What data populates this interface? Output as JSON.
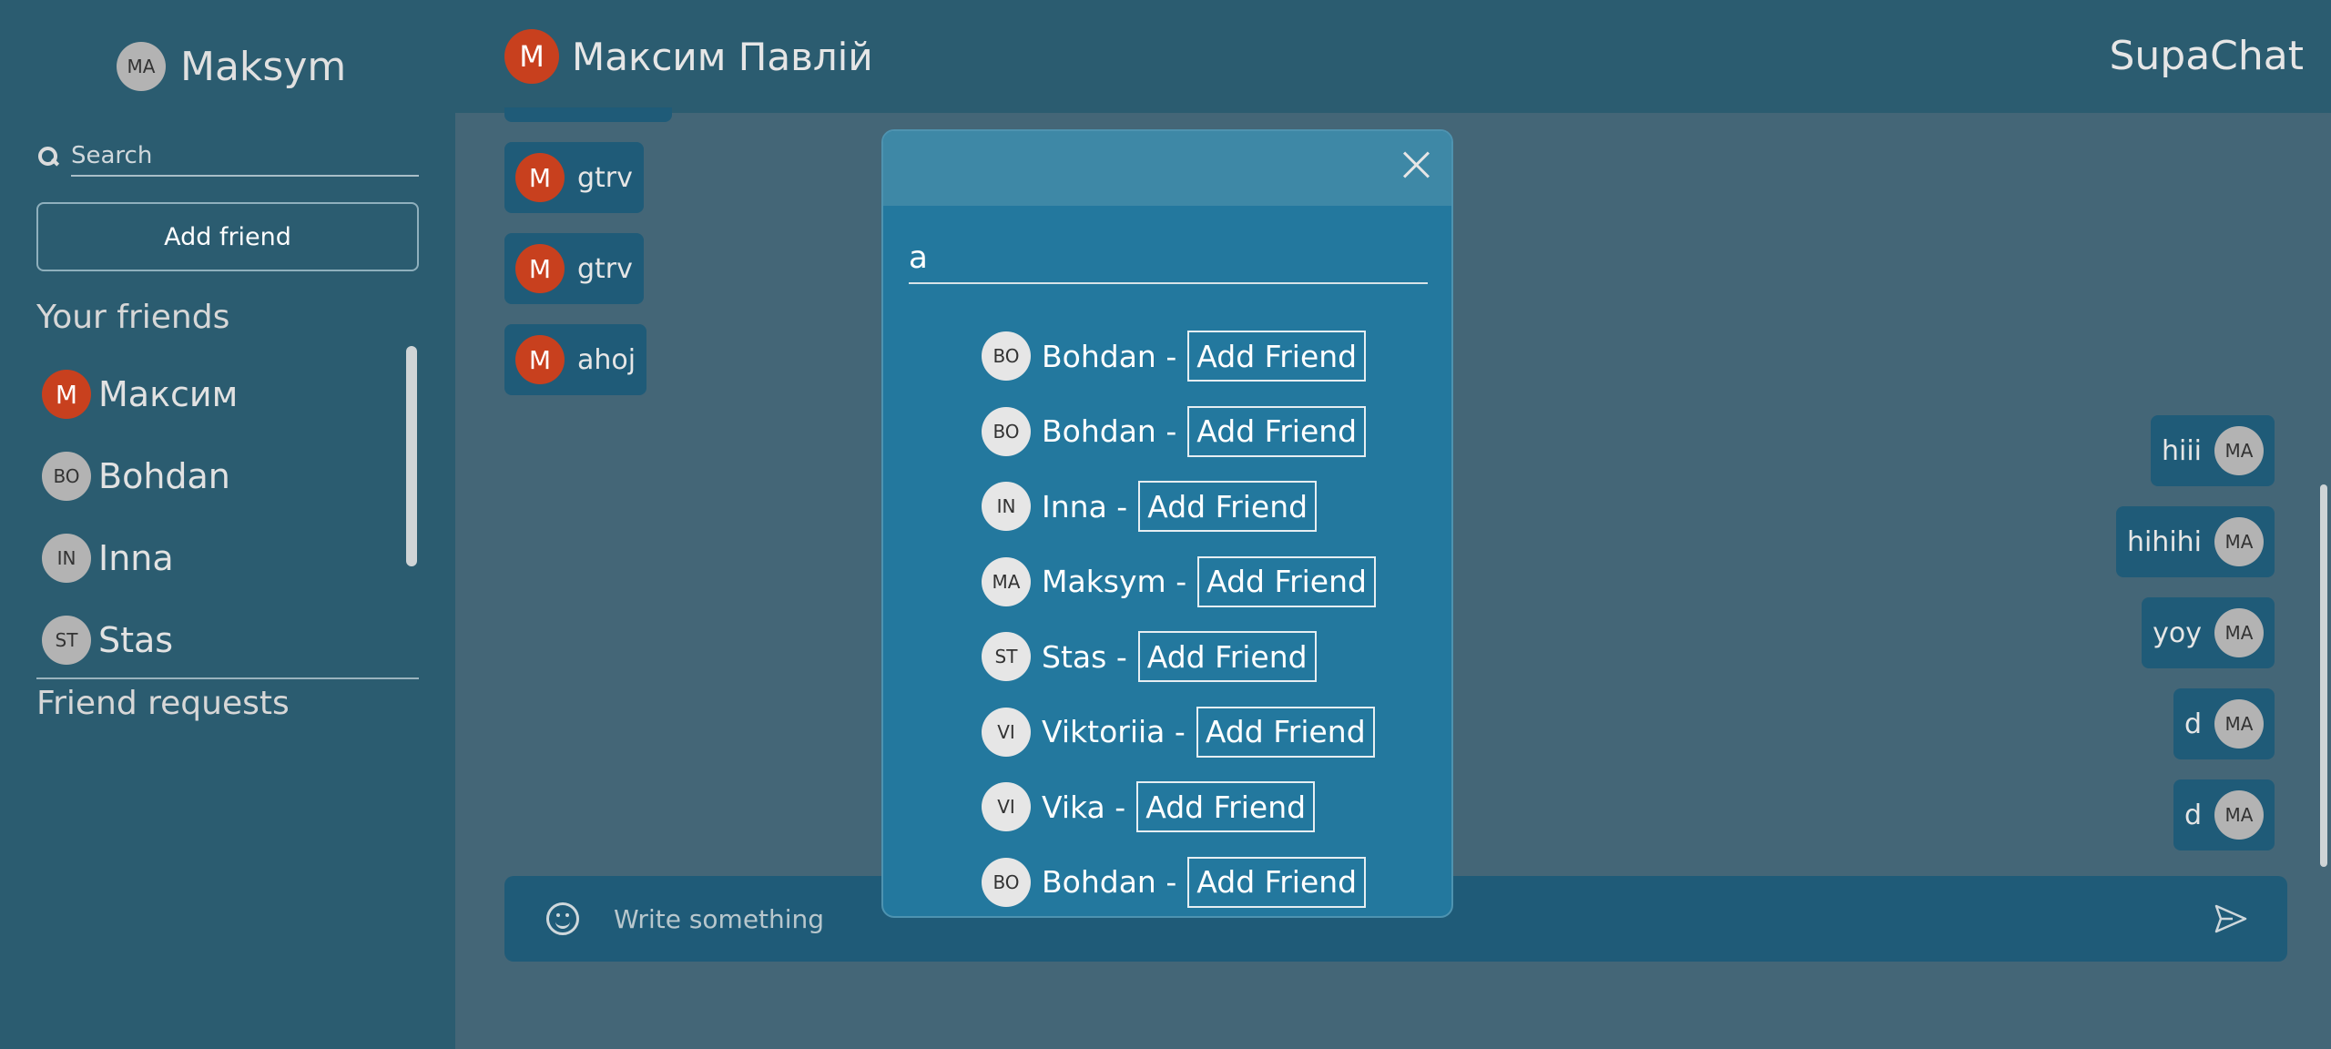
{
  "sidebar": {
    "user": {
      "initials": "MA",
      "name": "Maksym"
    },
    "search_placeholder": "Search",
    "add_friend_label": "Add friend",
    "friends_title": "Your friends",
    "friends": [
      {
        "initials": "M",
        "name": "Максим",
        "avatar_color": "#c8401e"
      },
      {
        "initials": "BO",
        "name": "Bohdan",
        "avatar_color": "#b3b3b3"
      },
      {
        "initials": "IN",
        "name": "Inna",
        "avatar_color": "#b3b3b3"
      },
      {
        "initials": "ST",
        "name": "Stas",
        "avatar_color": "#b3b3b3"
      }
    ],
    "requests_title": "Friend requests"
  },
  "header": {
    "contact_initials": "M",
    "contact_name": "Максим Павлій",
    "app_title": "SupaChat"
  },
  "chat": {
    "incoming": [
      {
        "initials": "M",
        "text": "gtrv"
      },
      {
        "initials": "M",
        "text": "gtrv"
      },
      {
        "initials": "M",
        "text": "ahoj"
      }
    ],
    "outgoing": [
      {
        "initials": "MA",
        "text": "hiii"
      },
      {
        "initials": "MA",
        "text": "hihihi"
      },
      {
        "initials": "MA",
        "text": "yoy"
      },
      {
        "initials": "MA",
        "text": "d"
      },
      {
        "initials": "MA",
        "text": "d"
      }
    ],
    "composer_placeholder": "Write something"
  },
  "modal": {
    "search_value": "a",
    "button_label": "Add Friend",
    "separator": "-",
    "results": [
      {
        "initials": "BO",
        "name": "Bohdan"
      },
      {
        "initials": "BO",
        "name": "Bohdan"
      },
      {
        "initials": "IN",
        "name": "Inna"
      },
      {
        "initials": "MA",
        "name": "Maksym"
      },
      {
        "initials": "ST",
        "name": "Stas"
      },
      {
        "initials": "VI",
        "name": "Viktoriia"
      },
      {
        "initials": "VI",
        "name": "Vika"
      },
      {
        "initials": "BO",
        "name": "Bohdan"
      }
    ]
  },
  "colors": {
    "sidebar_bg": "#2b5c70",
    "chat_bg": "#446677",
    "bubble_bg": "#1f5b78",
    "modal_bg": "#23789e",
    "modal_header_bg": "#3e88a6",
    "avatar_red": "#c8401e",
    "avatar_grey": "#b3b3b3"
  }
}
